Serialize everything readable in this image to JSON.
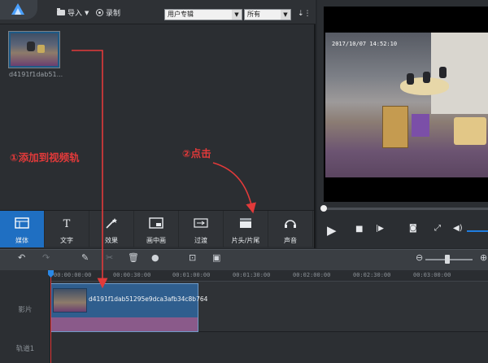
{
  "toolbar_top": {
    "import_label": "导入",
    "record_label": "录制",
    "category_select": "用户专辑",
    "filter_select": "所有"
  },
  "media": {
    "thumbnail_label": "d4191f1dab51..."
  },
  "annotations": {
    "step1": "①添加到视频轨",
    "step2": "②点击"
  },
  "tabs": [
    {
      "label": "媒体",
      "icon": "media-icon",
      "active": true
    },
    {
      "label": "文字",
      "icon": "text-icon",
      "active": false
    },
    {
      "label": "效果",
      "icon": "effects-icon",
      "active": false
    },
    {
      "label": "画中画",
      "icon": "pip-icon",
      "active": false
    },
    {
      "label": "过渡",
      "icon": "transition-icon",
      "active": false
    },
    {
      "label": "片头/片尾",
      "icon": "intro-outro-icon",
      "active": false
    },
    {
      "label": "声音",
      "icon": "sound-icon",
      "active": false
    }
  ],
  "preview": {
    "timestamp": "2017/10/07 14:52:10"
  },
  "timeline": {
    "ticks": [
      "00:00:00:00",
      "00:00:30:00",
      "00:01:00:00",
      "00:01:30:00",
      "00:02:00:00",
      "00:02:30:00",
      "00:03:00:00"
    ],
    "tracks": [
      "影片",
      "轨道1"
    ],
    "clip_label": "d4191f1dab51295e9dca3afb34c8b764"
  },
  "colors": {
    "active_tab": "#1f6fc2",
    "annotation": "#e23a3a",
    "clip": "#2f5e8e",
    "audio": "#8a5a8a"
  }
}
